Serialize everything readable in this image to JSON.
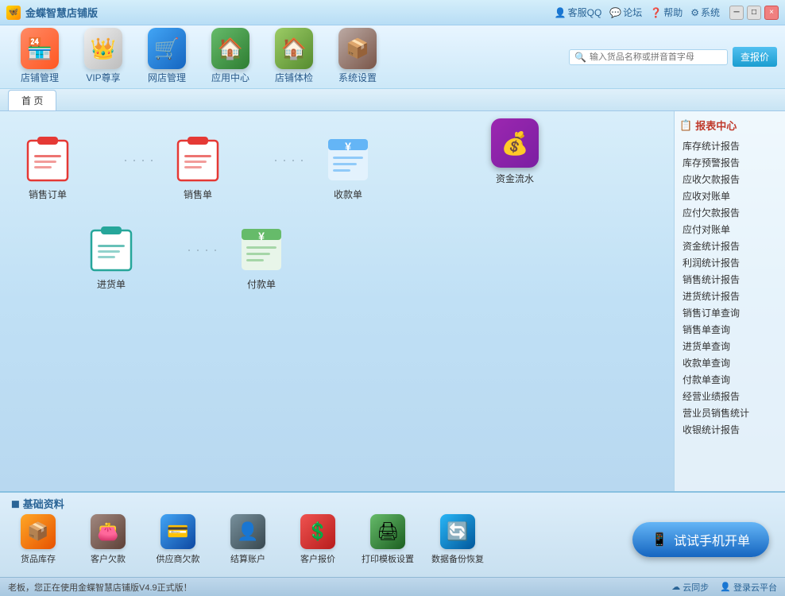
{
  "app": {
    "title": "金蝶智慧店铺版",
    "icon": "🦋"
  },
  "title_bar": {
    "links": [
      "客服QQ",
      "论坛",
      "帮助",
      "系统"
    ],
    "controls": [
      "─",
      "□",
      "×"
    ]
  },
  "top_nav": {
    "items": [
      {
        "id": "store",
        "label": "店铺管理",
        "icon": "🏪"
      },
      {
        "id": "vip",
        "label": "VIP尊享",
        "icon": "👑"
      },
      {
        "id": "online",
        "label": "网店管理",
        "icon": "🛒"
      },
      {
        "id": "apps",
        "label": "应用中心",
        "icon": "🏠"
      },
      {
        "id": "check",
        "label": "店铺体检",
        "icon": "🏠"
      },
      {
        "id": "sysset",
        "label": "系统设置",
        "icon": "📦"
      }
    ],
    "search": {
      "placeholder": "输入货品名称或拼音首字母",
      "button_label": "查报价"
    }
  },
  "tab": {
    "label": "首 页"
  },
  "main_grid": {
    "row1": [
      {
        "id": "sales-order",
        "label": "销售订单",
        "icon_type": "clipboard-red"
      },
      {
        "id": "sales-bill",
        "label": "销售单",
        "icon_type": "clipboard-red"
      },
      {
        "id": "receipt",
        "label": "收款单",
        "icon_type": "receipt"
      }
    ],
    "row2": [
      {
        "id": "purchase",
        "label": "进货单",
        "icon_type": "clipboard-teal"
      },
      {
        "id": "payment",
        "label": "付款单",
        "icon_type": "payment"
      }
    ],
    "standalone": {
      "id": "cashflow",
      "label": "资金流水",
      "icon_type": "money"
    }
  },
  "report_center": {
    "title": "报表中心",
    "items": [
      "库存统计报告",
      "库存预警报告",
      "应收欠款报告",
      "应收对账单",
      "应付欠款报告",
      "应付对账单",
      "资金统计报告",
      "利润统计报告",
      "销售统计报告",
      "进货统计报告",
      "销售订单查询",
      "销售单查询",
      "进货单查询",
      "收款单查询",
      "付款单查询",
      "经营业绩报告",
      "营业员销售统计",
      "收银统计报告"
    ]
  },
  "basic_data": {
    "title": "基础资料",
    "items": [
      {
        "id": "inventory",
        "label": "货品库存",
        "color": "#e8a030",
        "icon": "📦"
      },
      {
        "id": "receivable",
        "label": "客户欠款",
        "color": "#8b6914",
        "icon": "👛"
      },
      {
        "id": "payable",
        "label": "供应商欠款",
        "color": "#2196f3",
        "icon": "💳"
      },
      {
        "id": "account",
        "label": "结算账户",
        "color": "#607d8b",
        "icon": "👤"
      },
      {
        "id": "quotation",
        "label": "客户报价",
        "color": "#f44336",
        "icon": "💲"
      },
      {
        "id": "print",
        "label": "打印模板设置",
        "color": "#4caf50",
        "icon": "🖨"
      },
      {
        "id": "backup",
        "label": "数据备份恢复",
        "color": "#03a9f4",
        "icon": "🔄"
      }
    ],
    "mobile_btn": "试试手机开单"
  },
  "status_bar": {
    "message": "老板，您正在使用金蝶智慧店铺版V4.9正式版！",
    "links": [
      "云同步",
      "登录云平台"
    ]
  }
}
